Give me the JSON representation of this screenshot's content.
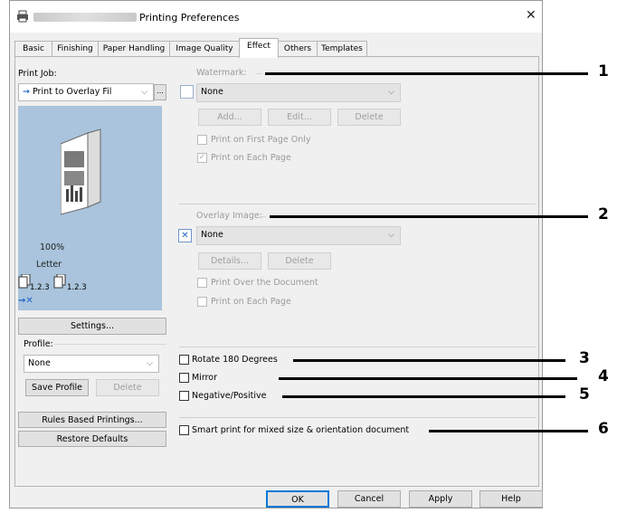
{
  "window": {
    "title": "Printing Preferences",
    "close_glyph": "✕"
  },
  "tabs": [
    {
      "label": "Basic"
    },
    {
      "label": "Finishing"
    },
    {
      "label": "Paper Handling"
    },
    {
      "label": "Image Quality"
    },
    {
      "label": "Effect"
    },
    {
      "label": "Others"
    },
    {
      "label": "Templates"
    }
  ],
  "left": {
    "print_job_label": "Print Job:",
    "print_job_value": "Print to Overlay Fil",
    "print_job_more": "...",
    "preview": {
      "zoom": "100%",
      "paper": "Letter",
      "page_a": "1.2.3",
      "page_b": "1.2.3"
    },
    "settings_button": "Settings...",
    "profile_label": "Profile:",
    "profile_value": "None",
    "save_profile_button": "Save Profile",
    "delete_button": "Delete",
    "rules_button": "Rules Based Printings...",
    "restore_button": "Restore Defaults"
  },
  "watermark": {
    "label": "Watermark:",
    "value": "None",
    "add_button": "Add...",
    "edit_button": "Edit...",
    "delete_button": "Delete",
    "first_page_only": "Print on First Page Only",
    "each_page": "Print on Each Page"
  },
  "overlay": {
    "label": "Overlay Image:",
    "value": "None",
    "details_button": "Details...",
    "delete_button": "Delete",
    "over_document": "Print Over the Document",
    "each_page": "Print on Each Page"
  },
  "options": {
    "rotate": "Rotate 180 Degrees",
    "mirror": "Mirror",
    "negative": "Negative/Positive",
    "smart_print": "Smart print for mixed size & orientation document"
  },
  "footer": {
    "ok": "OK",
    "cancel": "Cancel",
    "apply": "Apply",
    "help": "Help"
  },
  "callouts": [
    "1",
    "2",
    "3",
    "4",
    "5",
    "6"
  ]
}
